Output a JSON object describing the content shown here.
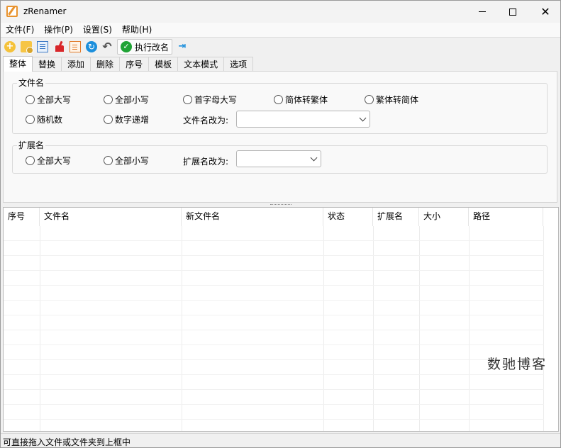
{
  "window": {
    "title": "zRenamer",
    "minimize_glyph": "minimize-icon",
    "maximize_glyph": "maximize-icon",
    "close_glyph": "✕"
  },
  "menu": [
    "文件(F)",
    "操作(P)",
    "设置(S)",
    "帮助(H)"
  ],
  "toolbar": {
    "add_glyph": "+",
    "refresh_glyph": "↻",
    "undo_glyph": "↶",
    "check_glyph": "✓",
    "execute_label": "执行改名",
    "pin_glyph": "⇥",
    "icons": [
      "add-file-icon",
      "add-folder-icon",
      "list-icon",
      "clear-broom-icon",
      "document-icon",
      "refresh-icon",
      "undo-icon",
      "pin-icon"
    ]
  },
  "tabs": [
    "整体",
    "替换",
    "添加",
    "删除",
    "序号",
    "模板",
    "文本模式",
    "选项"
  ],
  "active_tab": "整体",
  "filename_group": {
    "title": "文件名",
    "options": [
      "全部大写",
      "全部小写",
      "首字母大写",
      "简体转繁体",
      "繁体转简体",
      "随机数",
      "数字递增"
    ],
    "rename_label": "文件名改为:",
    "rename_value": ""
  },
  "extension_group": {
    "title": "扩展名",
    "options": [
      "全部大写",
      "全部小写"
    ],
    "rename_label": "扩展名改为:",
    "rename_value": ""
  },
  "table": {
    "columns": [
      "序号",
      "文件名",
      "新文件名",
      "状态",
      "扩展名",
      "大小",
      "路径"
    ],
    "rows": []
  },
  "watermark": "数驰博客",
  "status": "可直接拖入文件或文件夹到上框中",
  "colors": {
    "accent_orange": "#e8932e",
    "execute_green": "#1fa335",
    "refresh_blue": "#1c8fdc",
    "broom_red": "#d8262a"
  }
}
